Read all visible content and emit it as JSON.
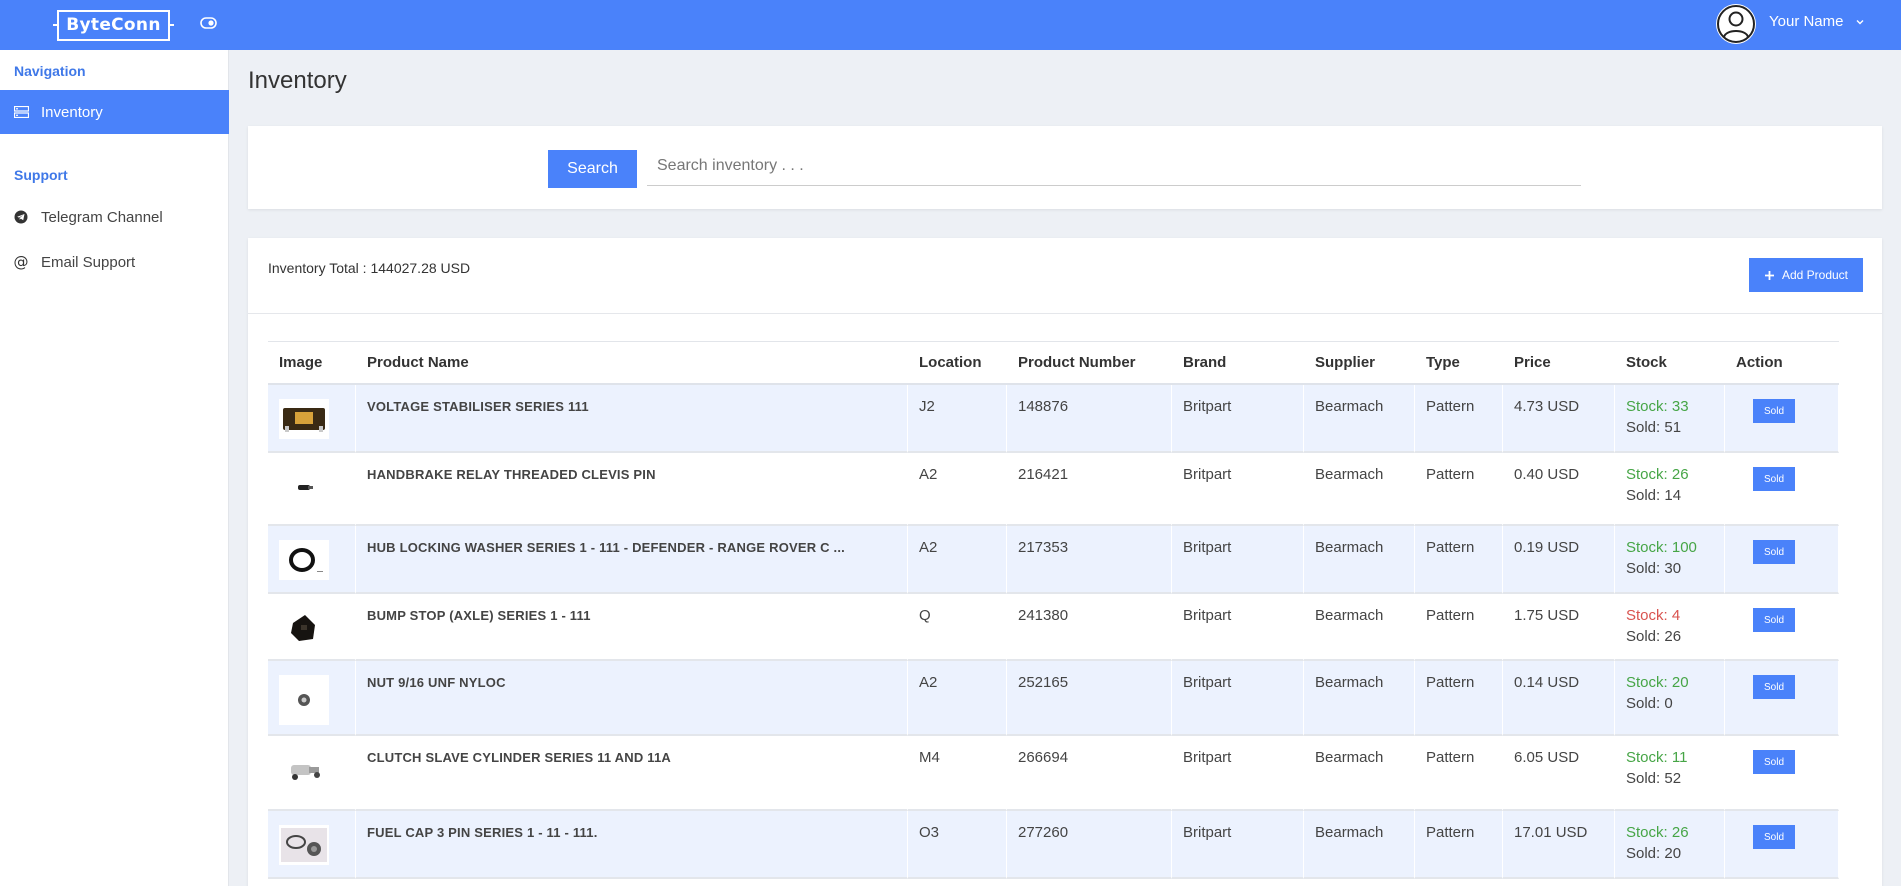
{
  "header": {
    "logo_text": "ByteConn",
    "user_name": "Your Name",
    "brand_color": "#4a82fa"
  },
  "sidebar": {
    "nav_heading": "Navigation",
    "support_heading": "Support",
    "items": [
      {
        "label": "Inventory",
        "icon": "server-icon",
        "active": true
      },
      {
        "label": "Telegram Channel",
        "icon": "telegram-icon",
        "active": false
      },
      {
        "label": "Email Support",
        "icon": "at-icon",
        "active": false
      }
    ]
  },
  "page": {
    "title": "Inventory"
  },
  "search": {
    "button_label": "Search",
    "placeholder": "Search inventory . . ."
  },
  "inventory": {
    "total_label": "Inventory Total : 144027.28 USD",
    "add_button_label": "Add Product",
    "columns": [
      "Image",
      "Product Name",
      "Location",
      "Product Number",
      "Brand",
      "Supplier",
      "Type",
      "Price",
      "Stock",
      "Action"
    ],
    "rows": [
      {
        "name": "VOLTAGE STABILISER SERIES 111",
        "location": "J2",
        "number": "148876",
        "brand": "Britpart",
        "supplier": "Bearmach",
        "type": "Pattern",
        "price": "4.73 USD",
        "stock": "Stock: 33",
        "sold": "Sold: 51",
        "low": false,
        "action": "Sold"
      },
      {
        "name": "HANDBRAKE RELAY THREADED CLEVIS PIN",
        "location": "A2",
        "number": "216421",
        "brand": "Britpart",
        "supplier": "Bearmach",
        "type": "Pattern",
        "price": "0.40 USD",
        "stock": "Stock: 26",
        "sold": "Sold: 14",
        "low": false,
        "action": "Sold"
      },
      {
        "name": "HUB LOCKING WASHER SERIES 1 - 111 - DEFENDER - RANGE ROVER C ...",
        "location": "A2",
        "number": "217353",
        "brand": "Britpart",
        "supplier": "Bearmach",
        "type": "Pattern",
        "price": "0.19 USD",
        "stock": "Stock: 100",
        "sold": "Sold: 30",
        "low": false,
        "action": "Sold"
      },
      {
        "name": "BUMP STOP (AXLE) SERIES 1 - 111",
        "location": "Q",
        "number": "241380",
        "brand": "Britpart",
        "supplier": "Bearmach",
        "type": "Pattern",
        "price": "1.75 USD",
        "stock": "Stock: 4",
        "sold": "Sold: 26",
        "low": true,
        "action": "Sold"
      },
      {
        "name": "NUT 9/16 UNF NYLOC",
        "location": "A2",
        "number": "252165",
        "brand": "Britpart",
        "supplier": "Bearmach",
        "type": "Pattern",
        "price": "0.14 USD",
        "stock": "Stock: 20",
        "sold": "Sold: 0",
        "low": false,
        "action": "Sold"
      },
      {
        "name": "CLUTCH SLAVE CYLINDER SERIES 11 AND 11A",
        "location": "M4",
        "number": "266694",
        "brand": "Britpart",
        "supplier": "Bearmach",
        "type": "Pattern",
        "price": "6.05 USD",
        "stock": "Stock: 11",
        "sold": "Sold: 52",
        "low": false,
        "action": "Sold"
      },
      {
        "name": "FUEL CAP 3 PIN SERIES 1 - 11 - 111.",
        "location": "O3",
        "number": "277260",
        "brand": "Britpart",
        "supplier": "Bearmach",
        "type": "Pattern",
        "price": "17.01 USD",
        "stock": "Stock: 26",
        "sold": "Sold: 20",
        "low": false,
        "action": "Sold"
      }
    ]
  }
}
